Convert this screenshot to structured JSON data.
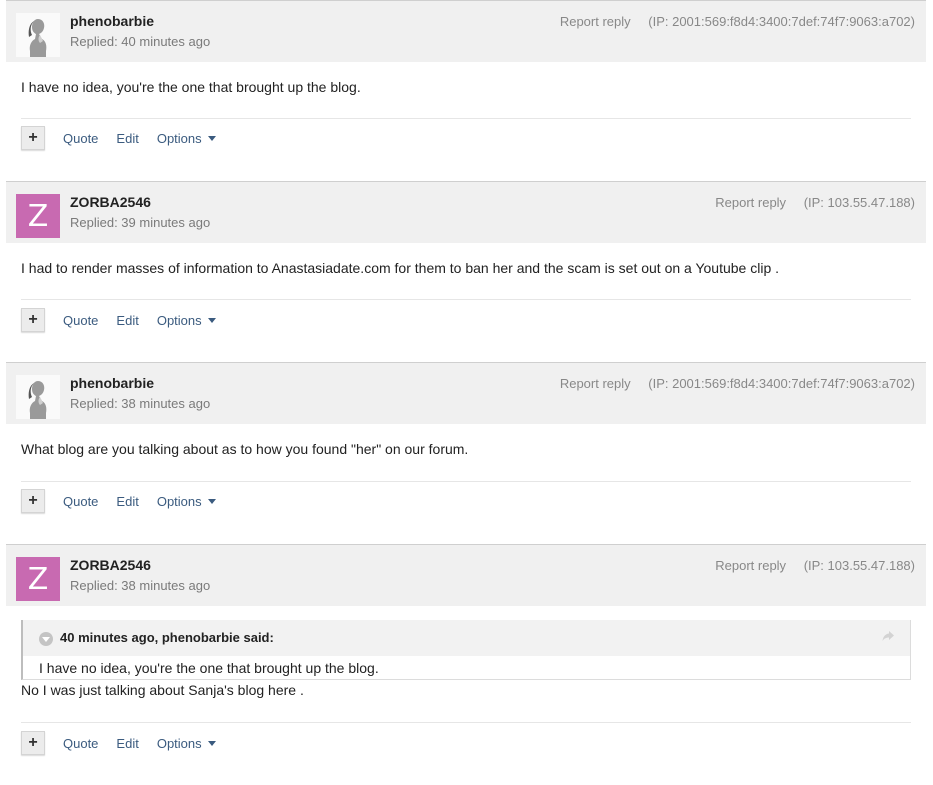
{
  "action_labels": {
    "quote": "Quote",
    "edit": "Edit",
    "options": "Options",
    "plus": "+"
  },
  "report_label": "Report reply",
  "posts": [
    {
      "author": "phenobarbie",
      "timestamp": "Replied: 40 minutes ago",
      "ip": "(IP: 2001:569:f8d4:3400:7def:74f7:9063:a702)",
      "avatar": {
        "type": "photo",
        "icon": "user-photo-avatar"
      },
      "body": "I have no idea, you're the one that brought up the blog."
    },
    {
      "author": "ZORBA2546",
      "timestamp": "Replied: 39 minutes ago",
      "ip": "(IP: 103.55.47.188)",
      "avatar": {
        "type": "letter",
        "letter": "Z",
        "color": "#c86ab1"
      },
      "body": "I had to render masses of information to Anastasiadate.com for them to ban her and the scam is set out on a Youtube clip ."
    },
    {
      "author": "phenobarbie",
      "timestamp": "Replied: 38 minutes ago",
      "ip": "(IP: 2001:569:f8d4:3400:7def:74f7:9063:a702)",
      "avatar": {
        "type": "photo",
        "icon": "user-photo-avatar"
      },
      "body": "What blog are you talking about as to how you found \"her\" on our forum."
    },
    {
      "author": "ZORBA2546",
      "timestamp": "Replied: 38 minutes ago",
      "ip": "(IP: 103.55.47.188)",
      "avatar": {
        "type": "letter",
        "letter": "Z",
        "color": "#c86ab1"
      },
      "quote": {
        "citation": "40 minutes ago, phenobarbie said:",
        "text": "I have no idea, you're the one that brought up the blog."
      },
      "body": "No I was just talking about Sanja's blog here ."
    }
  ]
}
